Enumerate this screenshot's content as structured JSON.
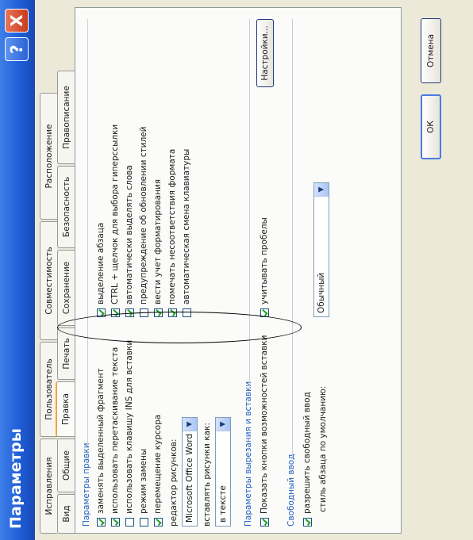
{
  "window": {
    "title": "Параметры",
    "help_icon": "question-icon",
    "help_label": "?",
    "close_icon": "close-icon",
    "close_label": "X"
  },
  "tabs": {
    "row1": [
      "Исправления",
      "Пользователь",
      "Совместимость",
      "Расположение"
    ],
    "row2": [
      "Вид",
      "Общие",
      "Правка",
      "Печать",
      "Сохранение",
      "Безопасность",
      "Правописание"
    ],
    "active": "Правка"
  },
  "edit_options": {
    "title": "Параметры правки",
    "left": [
      {
        "label": "заменять выделенный фрагмент",
        "checked": true
      },
      {
        "label": "использовать перетаскивание текста",
        "checked": true
      },
      {
        "label": "использовать клавишу INS для вставки",
        "checked": false
      },
      {
        "label": "режим замены",
        "checked": false
      },
      {
        "label": "перемещение курсора",
        "checked": true
      }
    ],
    "right": [
      {
        "label": "выделение абзаца",
        "checked": true
      },
      {
        "label": "CTRL + щелчок для выбора гиперссылки",
        "checked": true
      },
      {
        "label": "автоматически выделять слова",
        "checked": true
      },
      {
        "label": "предупреждение об обновлении стилей",
        "checked": false
      },
      {
        "label": "вести учет форматирования",
        "checked": true
      },
      {
        "label": "помечать несоответствия формата",
        "checked": true
      },
      {
        "label": "автоматическая смена клавиатуры",
        "checked": false
      }
    ],
    "picture_editor_label": "редактор рисунков:",
    "picture_editor_value": "Microsoft Office Word",
    "insert_pictures_label": "вставлять рисунки как:",
    "insert_pictures_value": "в тексте"
  },
  "cut_paste": {
    "title": "Параметры вырезания и вставки",
    "show_buttons": {
      "label": "Показать кнопки возможностей вставки",
      "checked": true
    },
    "smart_spaces": {
      "label": "учитывать пробелы",
      "checked": true
    },
    "settings_button": "Настройки..."
  },
  "free_input": {
    "title": "Свободный ввод",
    "allow": {
      "label": "разрешить свободный ввод",
      "checked": true
    },
    "default_style_label": "стиль абзаца по умолчанию:",
    "default_style_value": "Обычный"
  },
  "footer": {
    "ok": "ОК",
    "cancel": "Отмена"
  }
}
